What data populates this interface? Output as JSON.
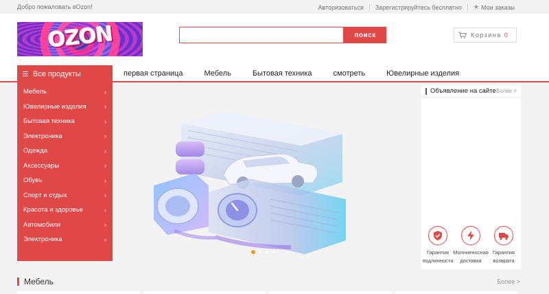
{
  "topbar": {
    "welcome": "Добро пожаловать вOzon!",
    "login": "Авторизоваться",
    "register": "Зарегистрируйтесь бесплатно",
    "orders": "Мои заказы"
  },
  "header": {
    "logo_text": "OZON",
    "search_value": "",
    "search_button": "поиск",
    "cart_label": "Корзина",
    "cart_count": "0"
  },
  "nav": {
    "all_products": "Все продукты",
    "links": [
      "первая страница",
      "Мебель",
      "Бытовая техника",
      "смотреть",
      "Ювелирные изделия"
    ]
  },
  "sidebar": {
    "items": [
      {
        "label": "Мебель"
      },
      {
        "label": "Ювелирные изделия"
      },
      {
        "label": "Бытовая техника"
      },
      {
        "label": "Электроника"
      },
      {
        "label": "Одежда"
      },
      {
        "label": "Аксессуары"
      },
      {
        "label": "Обувь"
      },
      {
        "label": "Спорт и отдых"
      },
      {
        "label": "Красота и здоровье"
      },
      {
        "label": "Автомобили"
      },
      {
        "label": "Электроника"
      }
    ],
    "arrow": "›"
  },
  "banner": {
    "dots": 4,
    "active_dot": 0
  },
  "announcements": {
    "title": "Объявление на сайте",
    "more": "Более >"
  },
  "features": [
    {
      "icon": "shield-check-icon",
      "label_line1": "Гарантия",
      "label_line2": "подлинности"
    },
    {
      "icon": "lightning-icon",
      "label_line1": "Молниеносная",
      "label_line2": "доставка"
    },
    {
      "icon": "truck-icon",
      "label_line1": "Гарантия",
      "label_line2": "возврата"
    }
  ],
  "section": {
    "title": "Мебель",
    "more": "Более >"
  },
  "colors": {
    "accent": "#e04848",
    "dot_active": "#f49a1a",
    "background": "#f3f3f3"
  }
}
